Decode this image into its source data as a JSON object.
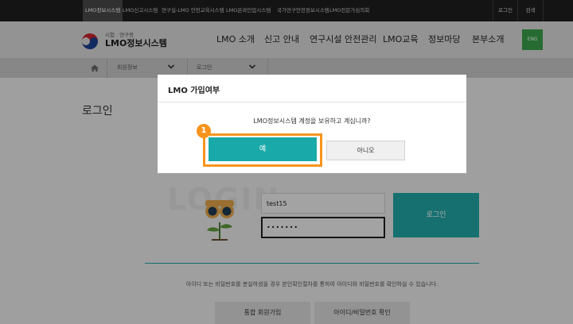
{
  "topbar": {
    "sites": [
      "LMO정보시스템",
      "LMO신고시스템",
      "연구실-LMO 안전교육시스템",
      "LMO온라인업시스템",
      "국가연구안전정보시스템",
      "LMO전문가심의회"
    ],
    "login": "로그인",
    "search": "검색"
  },
  "header": {
    "logo_sub": "시험 · 연구용",
    "logo_title": "LMO정보시스템",
    "nav": [
      "LMO 소개",
      "신고 안내",
      "연구시설 안전관리",
      "LMO교육",
      "정보마당",
      "본부소개"
    ],
    "eng": "ENG"
  },
  "breadcrumb": {
    "level1": "회원정보",
    "level2": "로그인"
  },
  "page": {
    "title": "로그인",
    "login_bg": "LOGIN",
    "id_value": "test15",
    "pw_value": "•••••••",
    "login_button": "로그인",
    "notice": "아이디 또는 비밀번호를 분실하셨을 경우 본인확인절차를 통하여 아이디와 비밀번호를 확인하실 수 있습니다.",
    "join_button": "통합 회원가입",
    "find_button": "아이디/비밀번호 확인"
  },
  "modal": {
    "title": "LMO 가입여부",
    "question": "LMO정보시스템 계정을 보유하고 계십니까?",
    "yes": "예",
    "no": "아니오",
    "step": "1"
  },
  "colors": {
    "teal": "#22a8a7",
    "accent_orange": "#f7941d",
    "eng_green": "#3aa24b"
  }
}
